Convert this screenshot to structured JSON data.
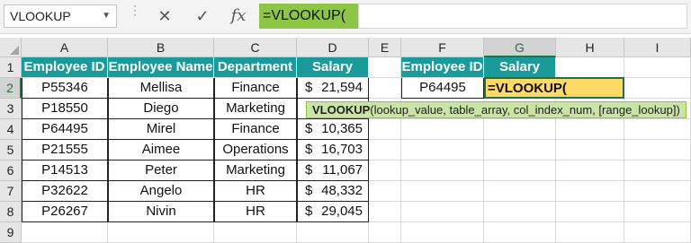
{
  "formula_bar": {
    "name_box": "VLOOKUP",
    "formula": "=VLOOKUP(",
    "cancel_icon": "close-icon",
    "enter_icon": "check-icon",
    "fx_label": "fx"
  },
  "columns": [
    "A",
    "B",
    "C",
    "D",
    "E",
    "F",
    "G",
    "H",
    "I"
  ],
  "rows": [
    "1",
    "2",
    "3",
    "4",
    "5",
    "6",
    "7",
    "8",
    "9"
  ],
  "table": {
    "headers": [
      "Employee ID",
      "Employee Name",
      "Department",
      "Salary"
    ],
    "currency": "$",
    "data": [
      [
        "P55346",
        "Mellisa",
        "Finance",
        "21,594"
      ],
      [
        "P18550",
        "Diego",
        "Marketing",
        ""
      ],
      [
        "P64495",
        "Mirel",
        "Finance",
        "10,365"
      ],
      [
        "P21555",
        "Aimee",
        "Operations",
        "16,703"
      ],
      [
        "P14513",
        "Peter",
        "Marketing",
        "11,067"
      ],
      [
        "P32622",
        "Angelo",
        "HR",
        "48,332"
      ],
      [
        "P26267",
        "Nivin",
        "HR",
        "29,045"
      ]
    ]
  },
  "lookup": {
    "headers": [
      "Employee ID",
      "Salary"
    ],
    "employee_id": "P64495",
    "active_formula": "=VLOOKUP("
  },
  "tooltip": {
    "function_name": "VLOOKUP",
    "args": "(lookup_value, table_array, col_index_num, [range_lookup])"
  },
  "colors": {
    "header_fill": "#1a9a9a",
    "formula_highlight": "#8dc544",
    "active_cell": "#ffd966"
  }
}
